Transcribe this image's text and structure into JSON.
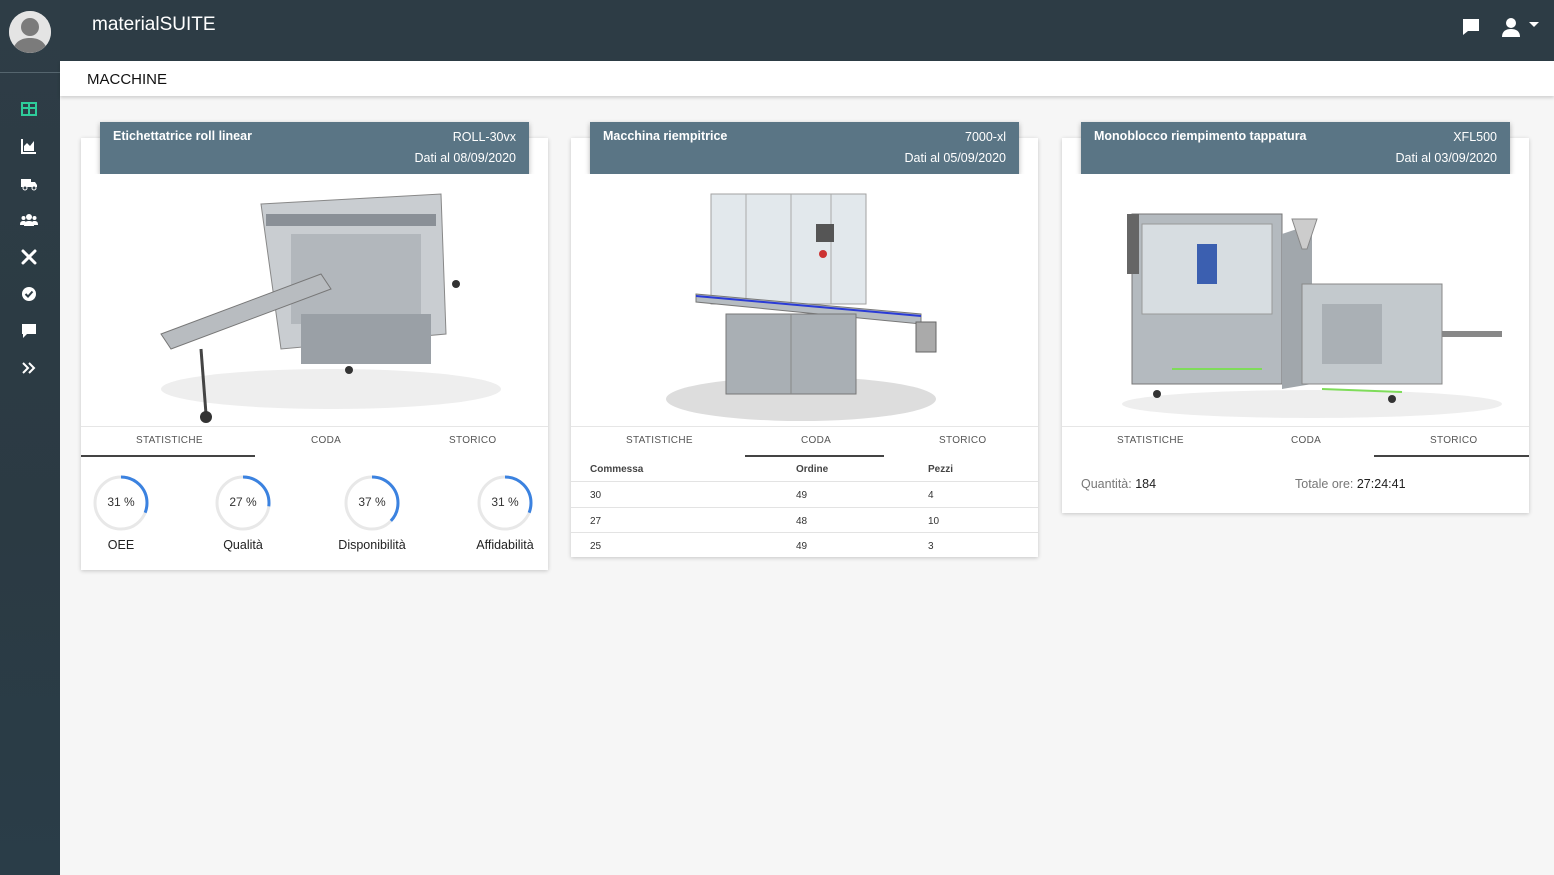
{
  "app": {
    "title": "materialSUITE"
  },
  "header": {
    "title": "MACCHINE"
  },
  "topbar": {
    "icons": [
      "chat-icon",
      "user-icon",
      "caret-down-icon"
    ]
  },
  "sidebar": {
    "items": [
      "dashboard-icon",
      "chart-icon",
      "truck-icon",
      "users-icon",
      "tools-icon",
      "check-circle-icon",
      "comment-icon",
      "expand-icon"
    ]
  },
  "tabs": [
    "STATISTICHE",
    "CODA",
    "STORICO"
  ],
  "cards": [
    {
      "name": "Etichettatrice roll linear",
      "code": "ROLL-30vx",
      "date": "Dati al 08/09/2020",
      "active_tab": "STATISTICHE",
      "gauges": [
        {
          "value": 31,
          "text": "31 %",
          "label": "OEE"
        },
        {
          "value": 27,
          "text": "27 %",
          "label": "Qualità"
        },
        {
          "value": 37,
          "text": "37 %",
          "label": "Disponibilità"
        },
        {
          "value": 31,
          "text": "31 %",
          "label": "Affidabilità"
        }
      ]
    },
    {
      "name": "Macchina riempitrice",
      "code": "7000-xl",
      "date": "Dati al 05/09/2020",
      "active_tab": "CODA",
      "table": {
        "headers": [
          "Commessa",
          "Ordine",
          "Pezzi"
        ],
        "rows": [
          [
            "30",
            "49",
            "4"
          ],
          [
            "27",
            "48",
            "10"
          ],
          [
            "25",
            "49",
            "3"
          ]
        ]
      }
    },
    {
      "name": "Monoblocco riempimento tappatura",
      "code": "XFL500",
      "date": "Dati al 03/09/2020",
      "active_tab": "STORICO",
      "quantity_label": "Quantità:",
      "quantity": "184",
      "hours_label": "Totale ore:",
      "hours": "27:24:41"
    }
  ],
  "colors": {
    "topbar": "#2d3c45",
    "card_header": "#5a7585",
    "gauge": "#3b82e0",
    "accent": "#2ecc9a"
  }
}
